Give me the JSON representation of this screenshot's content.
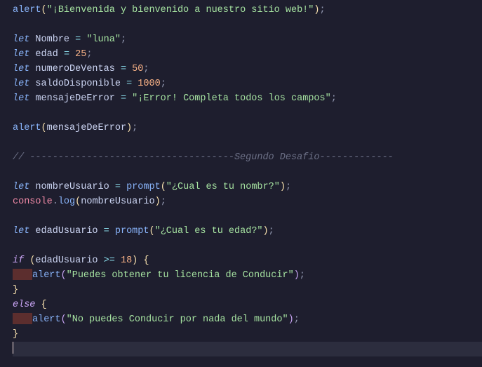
{
  "code": {
    "l1_fn": "alert",
    "l1_str": "\"¡Bienvenida y bienvenido a nuestro sitio web!\"",
    "l3_kw": "let",
    "l3_var": "Nombre",
    "l3_str": "\"luna\"",
    "l4_kw": "let",
    "l4_var": "edad",
    "l4_num": "25",
    "l5_kw": "let",
    "l5_var": "numeroDeVentas",
    "l5_num": "50",
    "l6_kw": "let",
    "l6_var": "saldoDisponible",
    "l6_num": "1000",
    "l7_kw": "let",
    "l7_var": "mensajeDeError",
    "l7_str": "\"¡Error! Completa todos los campos\"",
    "l9_fn": "alert",
    "l9_arg": "mensajeDeError",
    "l11_comment": "// ------------------------------------Segundo Desafio-------------",
    "l13_kw": "let",
    "l13_var": "nombreUsuario",
    "l13_fn": "prompt",
    "l13_str": "\"¿Cual es tu nombr?\"",
    "l14_obj": "console",
    "l14_method": "log",
    "l14_arg": "nombreUsuario",
    "l16_kw": "let",
    "l16_var": "edadUsuario",
    "l16_fn": "prompt",
    "l16_str": "\"¿Cual es tu edad?\"",
    "l18_if": "if",
    "l18_cond_var": "edadUsuario",
    "l18_op": ">=",
    "l18_num": "18",
    "l19_fn": "alert",
    "l19_str": "\"Puedes obtener tu licencia de Conducir\"",
    "l21_else": "else",
    "l22_fn": "alert",
    "l22_str": "\"No puedes Conducir por nada del mundo\""
  }
}
